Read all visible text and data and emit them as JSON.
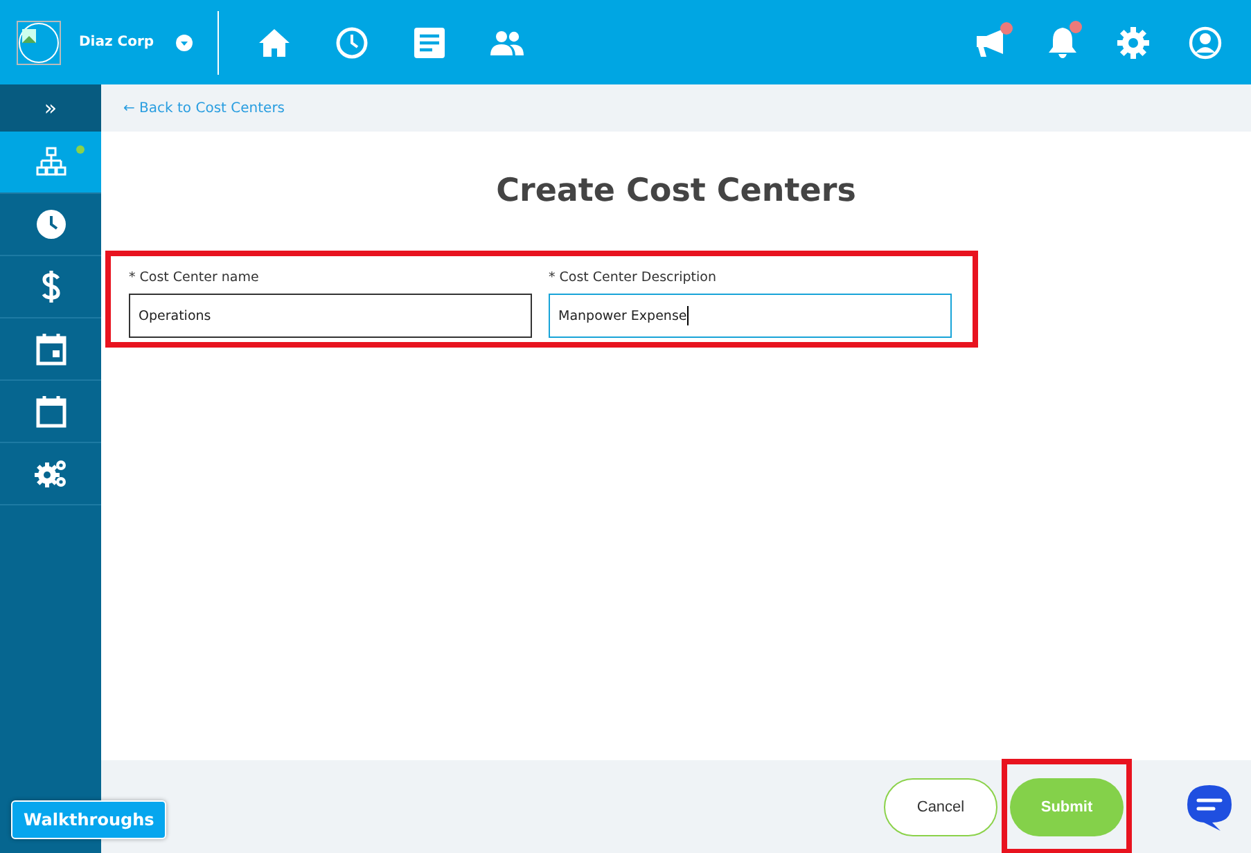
{
  "header": {
    "company": "Diaz Corp",
    "nav": [
      {
        "kind": "home"
      },
      {
        "kind": "clock"
      },
      {
        "kind": "document"
      },
      {
        "kind": "people"
      }
    ],
    "actions": [
      {
        "kind": "megaphone",
        "badge": true
      },
      {
        "kind": "bell",
        "badge": true
      },
      {
        "kind": "gear",
        "badge": false
      },
      {
        "kind": "user",
        "badge": false
      }
    ]
  },
  "sidebar": {
    "toggle": "»",
    "items": [
      {
        "kind": "hierarchy",
        "selected": true,
        "dot": true
      },
      {
        "kind": "clock",
        "selected": false,
        "dot": false
      },
      {
        "kind": "dollar",
        "selected": false,
        "dot": false
      },
      {
        "kind": "calendar-event",
        "selected": false,
        "dot": false
      },
      {
        "kind": "calendar",
        "selected": false,
        "dot": false
      },
      {
        "kind": "gears",
        "selected": false,
        "dot": false
      }
    ]
  },
  "back_link": "← Back to Cost Centers",
  "title": "Create Cost Centers",
  "fields": [
    {
      "label": "* Cost Center name",
      "value": "Operations",
      "focused": false
    },
    {
      "label": "* Cost Center Description",
      "value": "Manpower Expense",
      "focused": true
    }
  ],
  "buttons": [
    {
      "label": "Cancel",
      "kind": "outline",
      "highlighted": false
    },
    {
      "label": "Submit",
      "kind": "primary",
      "highlighted": true
    }
  ],
  "walkthroughs": "Walkthroughs"
}
